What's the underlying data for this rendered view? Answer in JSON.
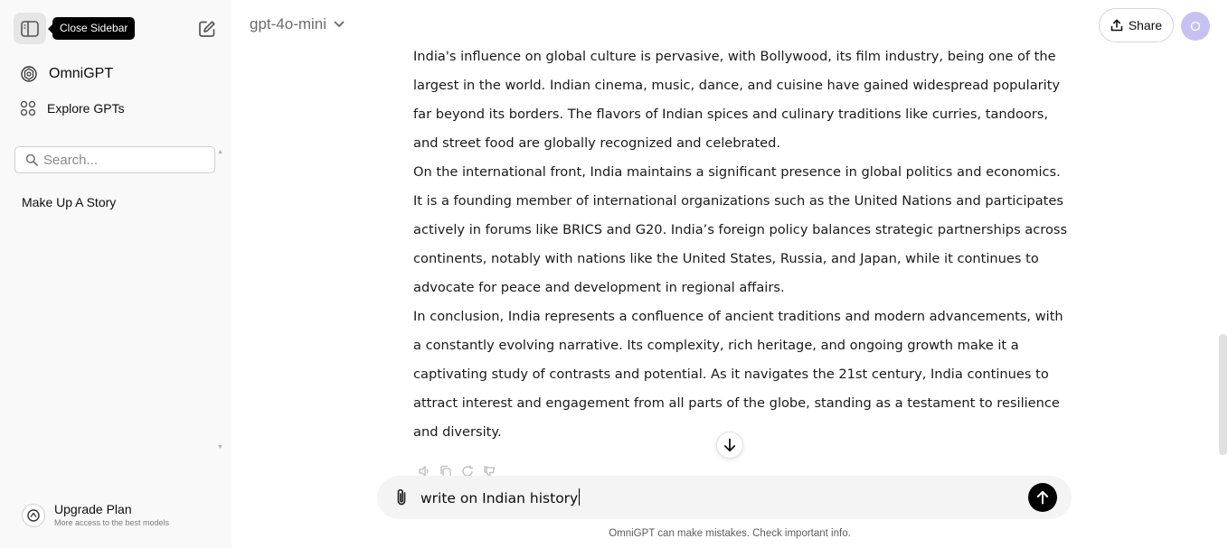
{
  "sidebar": {
    "toggle_tooltip": "Close Sidebar",
    "omni_label": "OmniGPT",
    "explore_label": "Explore GPTs",
    "search_placeholder": "Search...",
    "history": [
      "Make Up A Story"
    ],
    "upgrade_title": "Upgrade Plan",
    "upgrade_subtitle": "More access to the best models"
  },
  "header": {
    "model": "gpt-4o-mini",
    "share_label": "Share",
    "avatar_initial": "O"
  },
  "message": {
    "paragraphs": [
      "India's influence on global culture is pervasive, with Bollywood, its film industry, being one of the largest in the world. Indian cinema, music, dance, and cuisine have gained widespread popularity far beyond its borders. The flavors of Indian spices and culinary traditions like curries, tandoors, and street food are globally recognized and celebrated.",
      "On the international front, India maintains a significant presence in global politics and economics. It is a founding member of international organizations such as the United Nations and participates actively in forums like BRICS and G20. India’s foreign policy balances strategic partnerships across continents, notably with nations like the United States, Russia, and Japan, while it continues to advocate for peace and development in regional affairs.",
      "In conclusion, India represents a confluence of ancient traditions and modern advancements, with a constantly evolving narrative. Its complexity, rich heritage, and ongoing growth make it a captivating study of contrasts and potential. As it navigates the 21st century, India continues to attract interest and engagement from all parts of the globe, standing as a testament to resilience and diversity."
    ]
  },
  "composer": {
    "value": "write on Indian history"
  },
  "disclaimer": "OmniGPT can make mistakes. Check important info.",
  "colors": {
    "sidebar_bg": "#f9f9f9",
    "avatar_bg": "#c7c1f2",
    "send_bg": "#000000"
  }
}
